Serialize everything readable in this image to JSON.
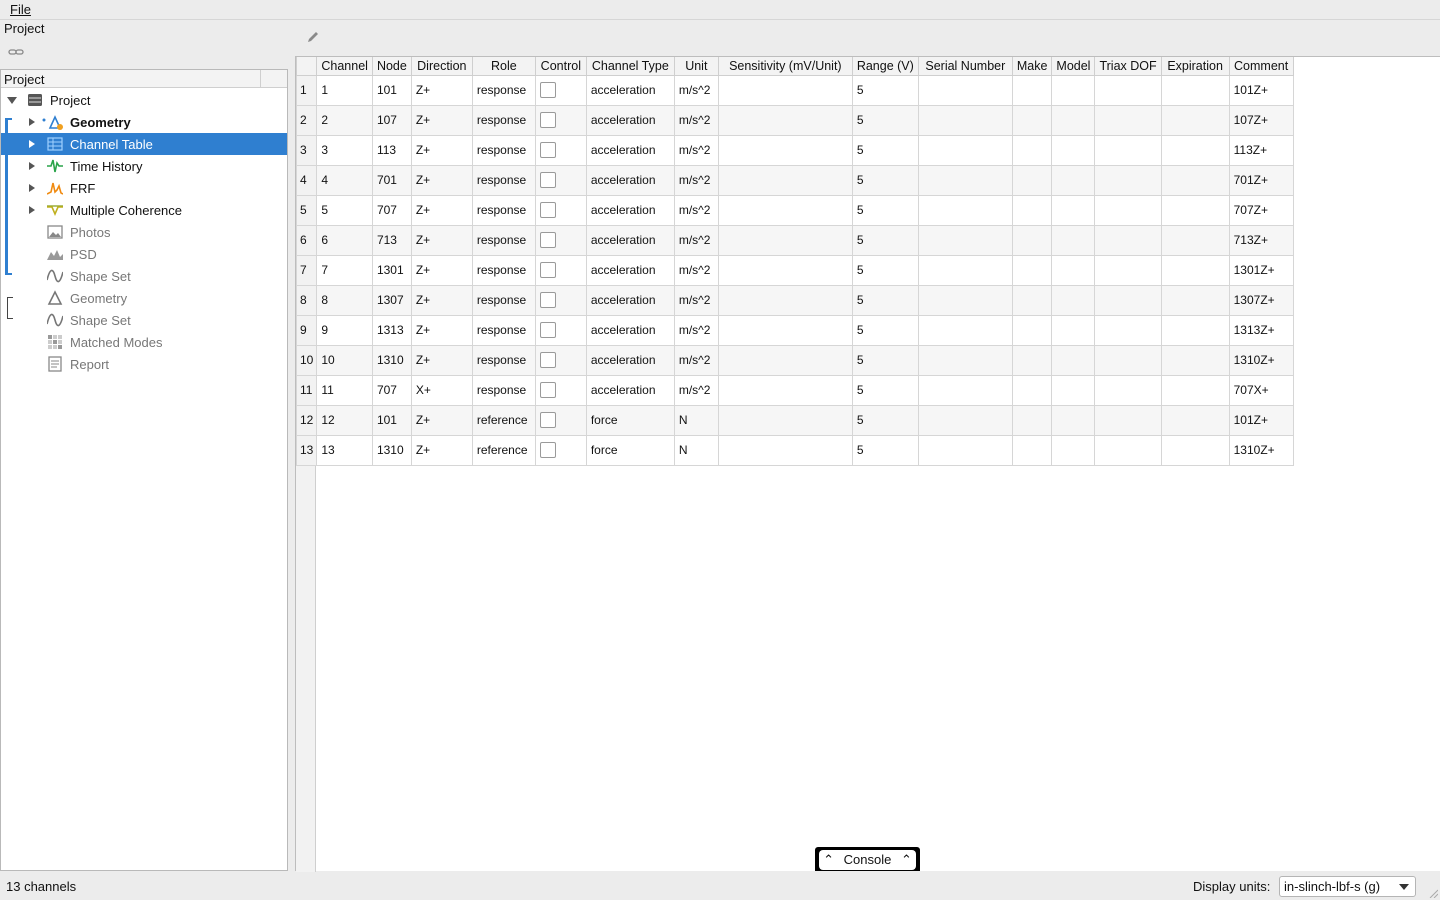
{
  "menu": {
    "file": "File"
  },
  "panel_title": "Project",
  "tree": {
    "header": "Project",
    "items": [
      {
        "label": "Project",
        "icon": "project-icon",
        "style": "normal"
      },
      {
        "label": "Geometry",
        "icon": "geometry-icon",
        "style": "bold"
      },
      {
        "label": "Channel Table",
        "icon": "table-icon",
        "style": "selected"
      },
      {
        "label": "Time History",
        "icon": "time-history-icon",
        "style": "normal"
      },
      {
        "label": "FRF",
        "icon": "frf-icon",
        "style": "normal"
      },
      {
        "label": "Multiple Coherence",
        "icon": "coherence-icon",
        "style": "normal"
      },
      {
        "label": "Photos",
        "icon": "photos-icon",
        "style": "grey"
      },
      {
        "label": "PSD",
        "icon": "psd-icon",
        "style": "grey"
      },
      {
        "label": "Shape Set",
        "icon": "shape-set-icon",
        "style": "grey"
      },
      {
        "label": "Geometry",
        "icon": "geometry-icon",
        "style": "grey"
      },
      {
        "label": "Shape Set",
        "icon": "shape-set-icon",
        "style": "grey"
      },
      {
        "label": "Matched Modes",
        "icon": "matched-modes-icon",
        "style": "grey"
      },
      {
        "label": "Report",
        "icon": "report-icon",
        "style": "grey"
      }
    ]
  },
  "table": {
    "columns": [
      "Channel",
      "Node",
      "Direction",
      "Role",
      "Control",
      "Channel Type",
      "Unit",
      "Sensitivity (mV/Unit)",
      "Range (V)",
      "Serial Number",
      "Make",
      "Model",
      "Triax DOF",
      "Expiration",
      "Comment"
    ],
    "rows": [
      [
        "1",
        "1",
        "101",
        "Z+",
        "response",
        "",
        "acceleration",
        "m/s^2",
        "",
        "5",
        "",
        "",
        "",
        "",
        "",
        "101Z+"
      ],
      [
        "2",
        "2",
        "107",
        "Z+",
        "response",
        "",
        "acceleration",
        "m/s^2",
        "",
        "5",
        "",
        "",
        "",
        "",
        "",
        "107Z+"
      ],
      [
        "3",
        "3",
        "113",
        "Z+",
        "response",
        "",
        "acceleration",
        "m/s^2",
        "",
        "5",
        "",
        "",
        "",
        "",
        "",
        "113Z+"
      ],
      [
        "4",
        "4",
        "701",
        "Z+",
        "response",
        "",
        "acceleration",
        "m/s^2",
        "",
        "5",
        "",
        "",
        "",
        "",
        "",
        "701Z+"
      ],
      [
        "5",
        "5",
        "707",
        "Z+",
        "response",
        "",
        "acceleration",
        "m/s^2",
        "",
        "5",
        "",
        "",
        "",
        "",
        "",
        "707Z+"
      ],
      [
        "6",
        "6",
        "713",
        "Z+",
        "response",
        "",
        "acceleration",
        "m/s^2",
        "",
        "5",
        "",
        "",
        "",
        "",
        "",
        "713Z+"
      ],
      [
        "7",
        "7",
        "1301",
        "Z+",
        "response",
        "",
        "acceleration",
        "m/s^2",
        "",
        "5",
        "",
        "",
        "",
        "",
        "",
        "1301Z+"
      ],
      [
        "8",
        "8",
        "1307",
        "Z+",
        "response",
        "",
        "acceleration",
        "m/s^2",
        "",
        "5",
        "",
        "",
        "",
        "",
        "",
        "1307Z+"
      ],
      [
        "9",
        "9",
        "1313",
        "Z+",
        "response",
        "",
        "acceleration",
        "m/s^2",
        "",
        "5",
        "",
        "",
        "",
        "",
        "",
        "1313Z+"
      ],
      [
        "10",
        "10",
        "1310",
        "Z+",
        "response",
        "",
        "acceleration",
        "m/s^2",
        "",
        "5",
        "",
        "",
        "",
        "",
        "",
        "1310Z+"
      ],
      [
        "11",
        "11",
        "707",
        "X+",
        "response",
        "",
        "acceleration",
        "m/s^2",
        "",
        "5",
        "",
        "",
        "",
        "",
        "",
        "707X+"
      ],
      [
        "12",
        "12",
        "101",
        "Z+",
        "reference",
        "",
        "force",
        "N",
        "",
        "5",
        "",
        "",
        "",
        "",
        "",
        "101Z+"
      ],
      [
        "13",
        "13",
        "1310",
        "Z+",
        "reference",
        "",
        "force",
        "N",
        "",
        "5",
        "",
        "",
        "",
        "",
        "",
        "1310Z+"
      ]
    ]
  },
  "console": {
    "label": "Console"
  },
  "status": {
    "channels": "13 channels",
    "units_label": "Display units:",
    "units_value": "in-slinch-lbf-s (g)"
  },
  "colors": {
    "selection": "#2f7fd0"
  }
}
